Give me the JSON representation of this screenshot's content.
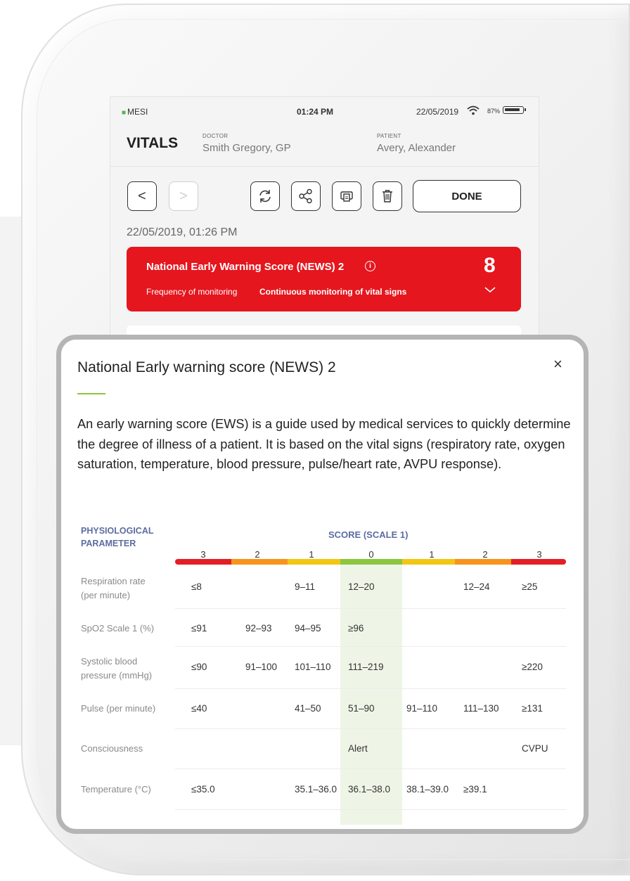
{
  "status_bar": {
    "carrier": "MESI",
    "time": "01:24 PM",
    "date": "22/05/2019",
    "battery": "87%"
  },
  "header": {
    "title": "VITALS",
    "doctor_label": "DOCTOR",
    "doctor_name": "Smith Gregory, GP",
    "patient_label": "PATIENT",
    "patient_name": "Avery, Alexander"
  },
  "toolbar": {
    "back_glyph": "<",
    "forward_glyph": ">",
    "done_label": "DONE"
  },
  "measurement": {
    "timestamp": "22/05/2019, 01:26 PM",
    "news_title": "National Early Warning Score (NEWS) 2",
    "news_score": "8",
    "frequency_label": "Frequency of monitoring",
    "frequency_value": "Continuous monitoring of vital signs",
    "card_color": "#e5161e"
  },
  "modal": {
    "title": "National Early warning score (NEWS) 2",
    "close_glyph": "×",
    "description": "An early warning score (EWS) is a guide used by medical services to quickly determine the degree of illness of a patient. It is based on the vital signs (respiratory rate, oxygen saturation, temperature, blood pressure, pulse/heart rate, AVPU response).",
    "table": {
      "param_header_line1": "PHYSIOLOGICAL",
      "param_header_line2": "PARAMETER",
      "score_header": "SCORE (SCALE 1)",
      "score_columns": [
        "3",
        "2",
        "1",
        "0",
        "1",
        "2",
        "3"
      ],
      "column_colors": [
        "#e31e24",
        "#f7941d",
        "#f3c614",
        "#8cc63f",
        "#f3c614",
        "#f7941d",
        "#e31e24"
      ],
      "rows": [
        {
          "param_line1": "Respiration rate",
          "param_line2": "(per minute)",
          "cells": [
            "≤8",
            "",
            "9–11",
            "12–20",
            "",
            "12–24",
            "≥25"
          ]
        },
        {
          "param_line1": "SpO2 Scale 1 (%)",
          "param_line2": "",
          "cells": [
            "≤91",
            "92–93",
            "94–95",
            "≥96",
            "",
            "",
            ""
          ]
        },
        {
          "param_line1": "Systolic blood",
          "param_line2": "pressure (mmHg)",
          "cells": [
            "≤90",
            "91–100",
            "101–110",
            "111–219",
            "",
            "",
            "≥220"
          ]
        },
        {
          "param_line1": "Pulse (per minute)",
          "param_line2": "",
          "cells": [
            "≤40",
            "",
            "41–50",
            "51–90",
            "91–110",
            "111–130",
            "≥131"
          ]
        },
        {
          "param_line1": "Consciousness",
          "param_line2": "",
          "cells": [
            "",
            "",
            "",
            "Alert",
            "",
            "",
            "CVPU"
          ]
        },
        {
          "param_line1": "Temperature (°C)",
          "param_line2": "",
          "cells": [
            "≤35.0",
            "",
            "35.1–36.0",
            "36.1–38.0",
            "38.1–39.0",
            "≥39.1",
            ""
          ]
        }
      ]
    }
  }
}
